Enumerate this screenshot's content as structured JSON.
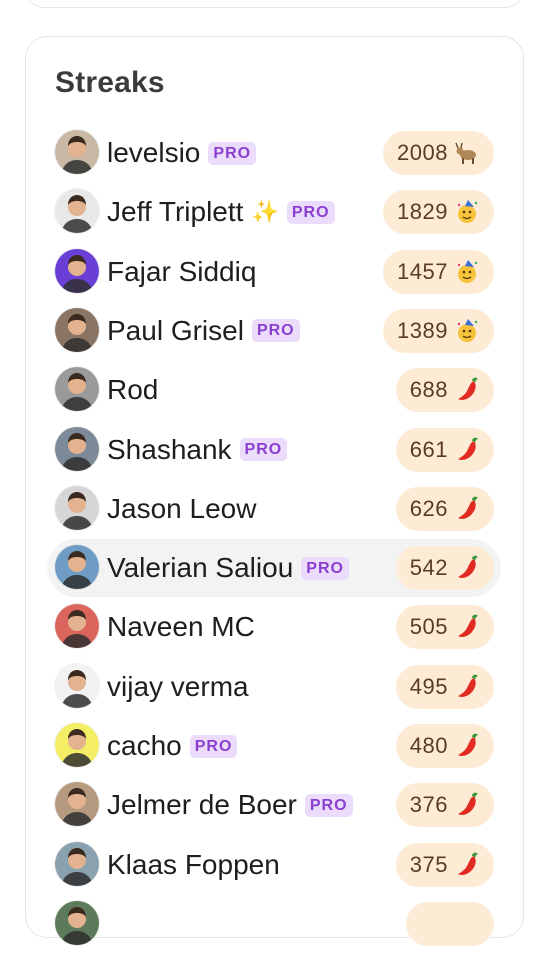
{
  "panel": {
    "title": "Streaks"
  },
  "rows": [
    {
      "name": "levelsio",
      "pro": "PRO",
      "streak": "2008",
      "icon": "goat-icon",
      "avatar": "#c9b8a3"
    },
    {
      "name": "Jeff Triplett",
      "sparkle": "✨",
      "pro": "PRO",
      "streak": "1829",
      "icon": "party-face-icon",
      "avatar": "#e8e8e8"
    },
    {
      "name": "Fajar Siddiq",
      "streak": "1457",
      "icon": "party-face-icon",
      "avatar": "#6a3fd6"
    },
    {
      "name": "Paul Grisel",
      "pro": "PRO",
      "streak": "1389",
      "icon": "party-face-icon",
      "avatar": "#8a7565"
    },
    {
      "name": "Rod",
      "streak": "688",
      "icon": "chili-pepper-icon",
      "avatar": "#9a9a9a"
    },
    {
      "name": "Shashank",
      "pro": "PRO",
      "streak": "661",
      "icon": "chili-pepper-icon",
      "avatar": "#7d8a99"
    },
    {
      "name": "Jason Leow",
      "streak": "626",
      "icon": "chili-pepper-icon",
      "avatar": "#d6d6d6"
    },
    {
      "name": "Valerian Saliou",
      "pro": "PRO",
      "streak": "542",
      "icon": "chili-pepper-icon",
      "avatar": "#6f9cc4",
      "highlight": true
    },
    {
      "name": "Naveen MC",
      "streak": "505",
      "icon": "chili-pepper-icon",
      "avatar": "#d9655d"
    },
    {
      "name": "vijay verma",
      "streak": "495",
      "icon": "chili-pepper-icon",
      "avatar": "#f2f2f2"
    },
    {
      "name": "cacho",
      "pro": "PRO",
      "streak": "480",
      "icon": "chili-pepper-icon",
      "avatar": "#f4ee66"
    },
    {
      "name": "Jelmer de Boer",
      "pro": "PRO",
      "streak": "376",
      "icon": "chili-pepper-icon",
      "avatar": "#b59a80"
    },
    {
      "name": "Klaas Foppen",
      "streak": "375",
      "icon": "chili-pepper-icon",
      "avatar": "#8aa1b0"
    },
    {
      "name": "",
      "streak": "",
      "icon": "",
      "avatar": "#5d7a5a"
    }
  ]
}
